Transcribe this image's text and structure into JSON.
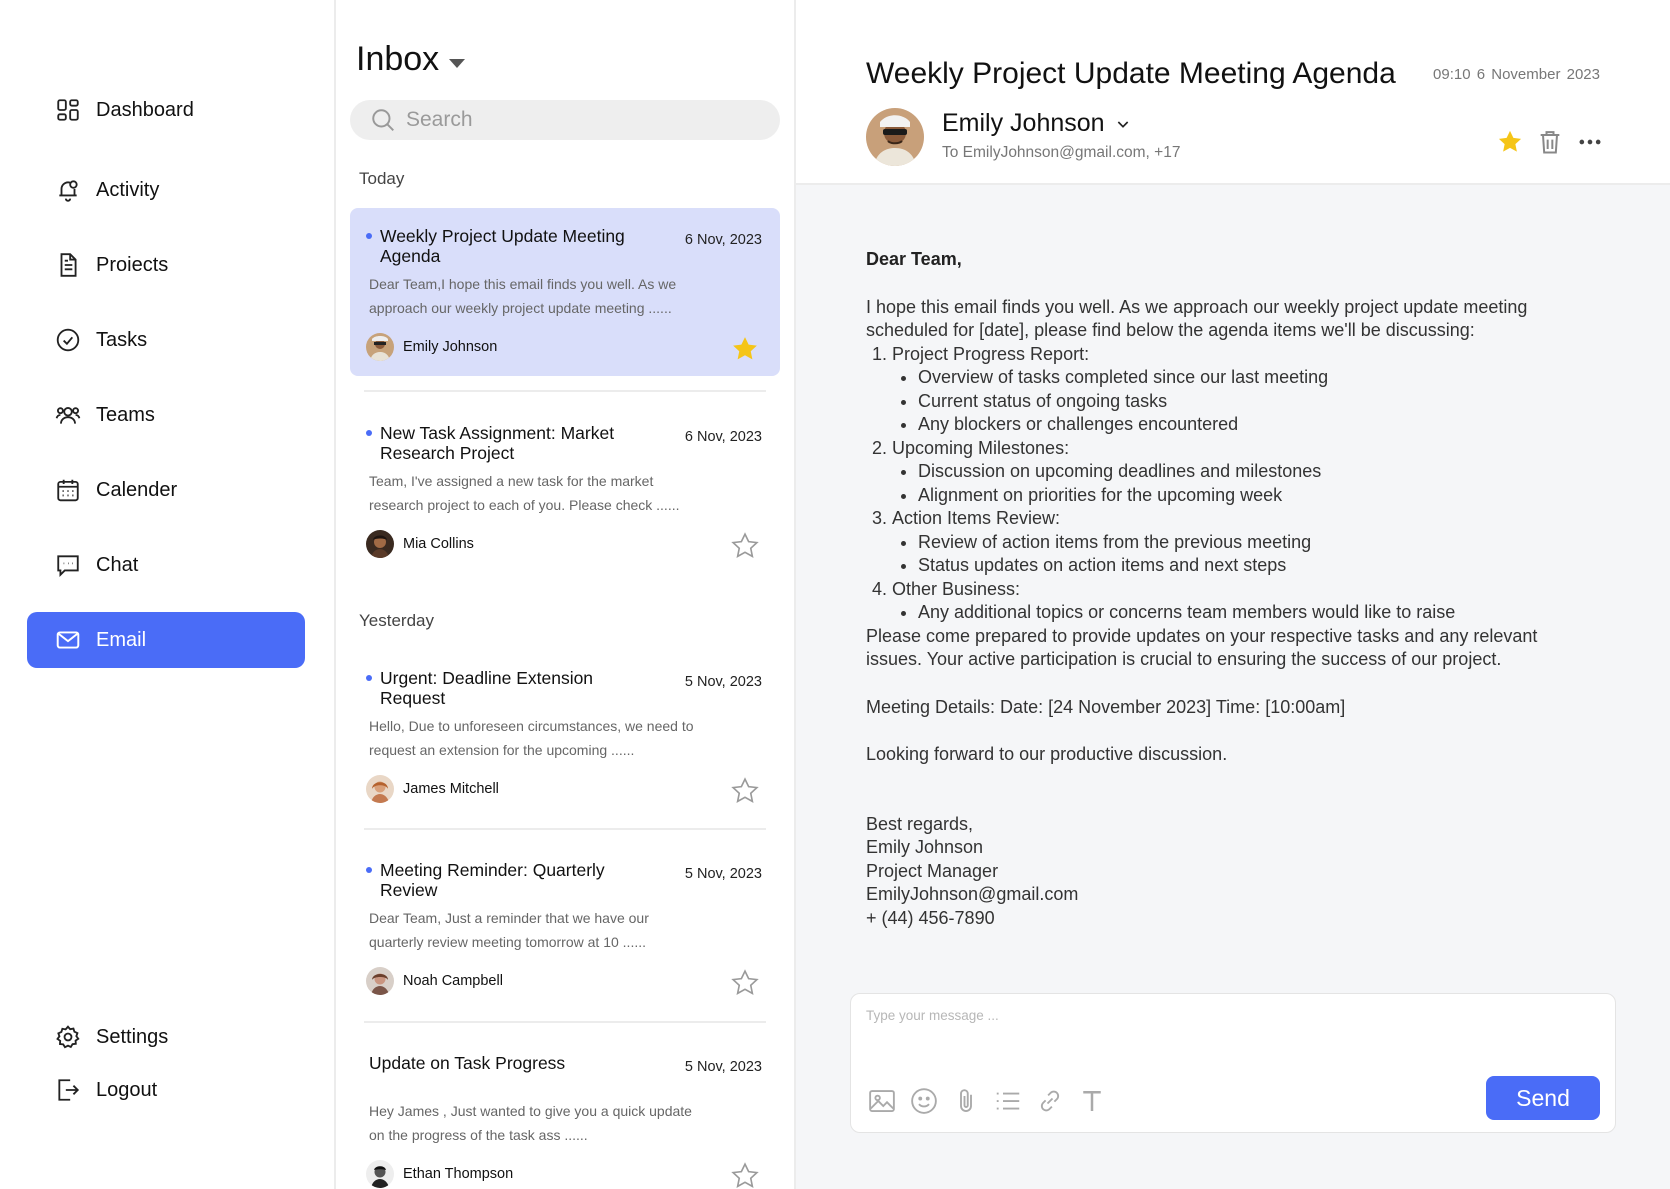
{
  "nav": {
    "items": [
      {
        "label": "Dashboard",
        "icon": "dashboard-icon"
      },
      {
        "label": "Activity",
        "icon": "bell-icon"
      },
      {
        "label": "Proiects",
        "icon": "document-icon"
      },
      {
        "label": "Tasks",
        "icon": "check-circle-icon"
      },
      {
        "label": "Teams",
        "icon": "users-icon"
      },
      {
        "label": "Calender",
        "icon": "calendar-icon"
      },
      {
        "label": "Chat",
        "icon": "chat-icon"
      },
      {
        "label": "Email",
        "icon": "mail-icon",
        "active": true
      }
    ],
    "settings_label": "Settings",
    "logout_label": "Logout"
  },
  "inbox": {
    "title": "Inbox",
    "search_placeholder": "Search",
    "groups": {
      "today": "Today",
      "yesterday": "Yesterday"
    },
    "mails": [
      {
        "subject": "Weekly Project Update Meeting Agenda",
        "date": "6 Nov, 2023",
        "preview": "Dear Team,I hope this email finds you well. As we approach our weekly project update meeting ......",
        "sender": "Emily Johnson",
        "starred": true,
        "unread": true,
        "selected": true
      },
      {
        "subject": "New Task Assignment: Market Research Project",
        "date": "6 Nov, 2023",
        "preview": "Team, I've assigned a new task for the market research project to each of you. Please check ......",
        "sender": "Mia Collins",
        "starred": false,
        "unread": true
      },
      {
        "subject": "Urgent: Deadline Extension Request",
        "date": "5 Nov, 2023",
        "preview": "Hello, Due to unforeseen circumstances, we need to request an extension for the upcoming ......",
        "sender": "James Mitchell",
        "starred": false,
        "unread": true
      },
      {
        "subject": "Meeting Reminder: Quarterly Review",
        "date": "5 Nov, 2023",
        "preview": "Dear Team, Just a reminder that we have our quarterly review meeting tomorrow at 10 ......",
        "sender": "Noah Campbell",
        "starred": false,
        "unread": true
      },
      {
        "subject": "Update on Task Progress",
        "date": "5 Nov, 2023",
        "preview": "Hey James , Just wanted to give you a quick update on the progress of the task ass ......",
        "sender": "Ethan Thompson",
        "starred": false,
        "unread": false
      }
    ]
  },
  "reader": {
    "title": "Weekly Project Update Meeting Agenda",
    "time": "09:10",
    "date": "6 November 2023",
    "from_name": "Emily Johnson",
    "to_line": "To EmilyJohnson@gmail.com, +17",
    "greeting": "Dear Team,",
    "intro": "I hope this email finds you well. As we approach our weekly project update meeting scheduled for [date], please find below the agenda items we'll be discussing:",
    "agenda": [
      {
        "title": "Project Progress Report:",
        "items": [
          "Overview of tasks completed since our last meeting",
          "Current status of ongoing tasks",
          "Any blockers or challenges encountered"
        ]
      },
      {
        "title": "Upcoming Milestones:",
        "items": [
          "Discussion on upcoming deadlines and milestones",
          "Alignment on priorities for the upcoming week"
        ]
      },
      {
        "title": "Action Items Review:",
        "items": [
          "Review of action items from the previous meeting",
          "Status updates on action items and next steps"
        ]
      },
      {
        "title": "Other Business:",
        "items": [
          "Any additional topics or concerns team members would like to raise"
        ]
      }
    ],
    "closing_para": "Please come prepared to provide updates on your respective tasks and any relevant issues. Your active participation is crucial to ensuring the success of our project.",
    "meeting_details": "Meeting Details: Date: [24 November 2023] Time: [10:00am]",
    "looking_forward": "Looking forward to our productive discussion.",
    "signature": [
      "Best regards,",
      "Emily Johnson",
      "Project Manager",
      "EmilyJohnson@gmail.com",
      "+ (44) 456-7890"
    ]
  },
  "composer": {
    "placeholder": "Type your message ...",
    "send_label": "Send"
  },
  "colors": {
    "accent": "#4a6cf7",
    "selected_bg": "#d9defa",
    "star": "#f5c518"
  }
}
